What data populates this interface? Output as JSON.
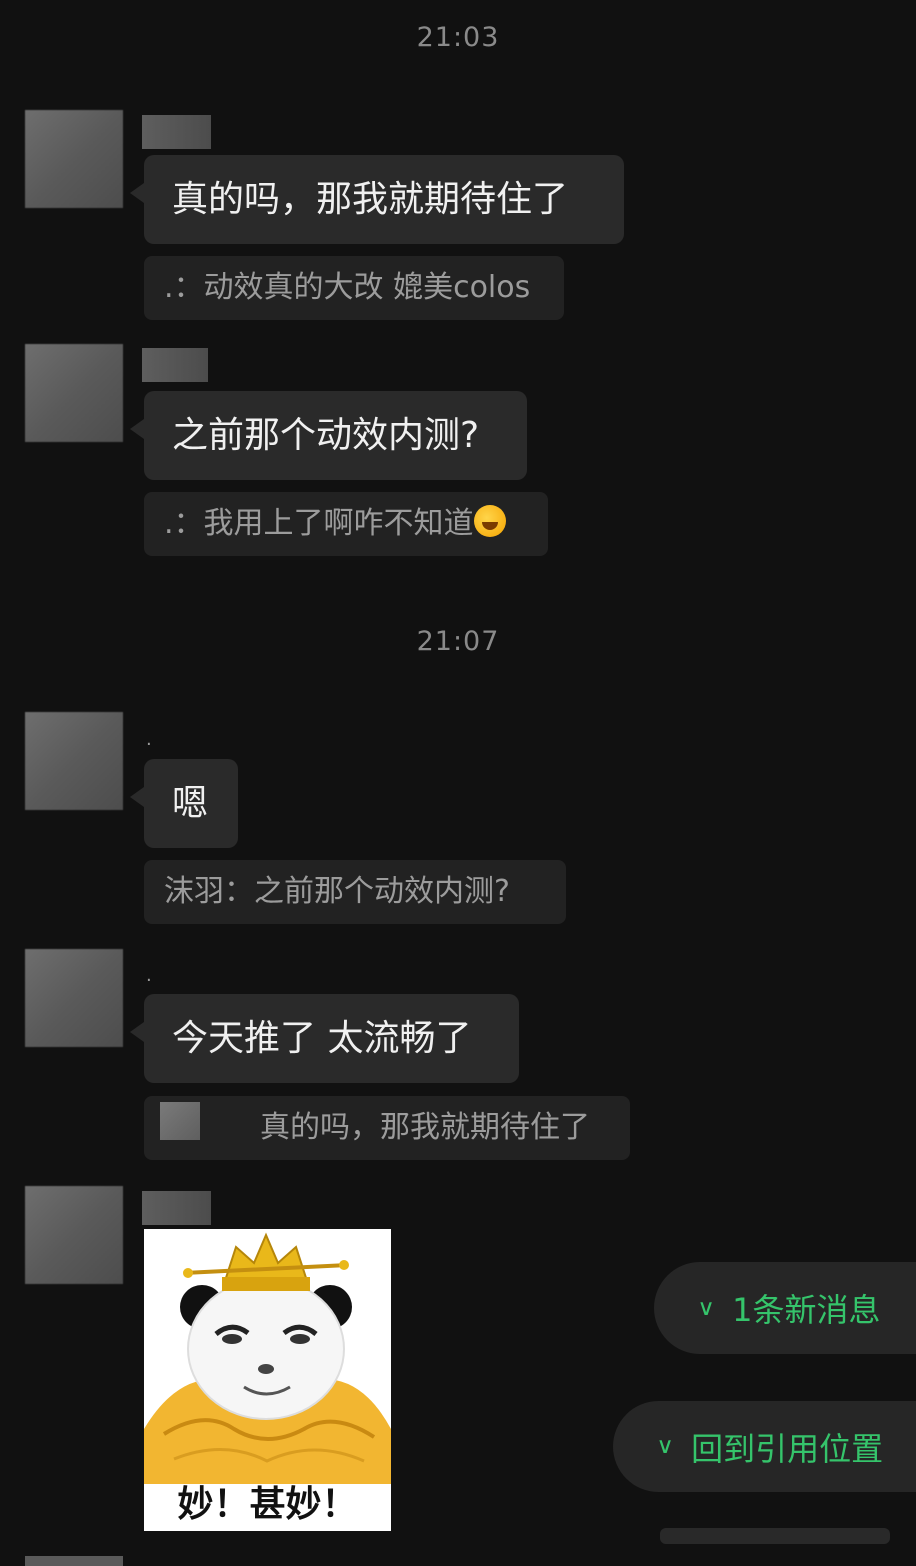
{
  "timestamps": [
    "21:03",
    "21:07"
  ],
  "messages": [
    {
      "text": "真的吗，那我就期待住了",
      "quote": ".：动效真的大改 媲美colos"
    },
    {
      "text": "之前那个动效内测?",
      "quote": ".：我用上了啊咋不知道"
    },
    {
      "sender": ".",
      "text": "嗯",
      "quote": "沫羽：之前那个动效内测?"
    },
    {
      "sender": ".",
      "text": "今天推了 太流畅了",
      "quote": "真的吗，那我就期待住了"
    },
    {
      "sticker_caption": "妙！甚妙！"
    }
  ],
  "icons": {
    "quote_emoji": "crying-laughing-emoji",
    "chevron": "double-chevron-down-icon"
  },
  "floating": {
    "new_messages": "1条新消息",
    "back_to_quote": "回到引用位置"
  },
  "colors": {
    "background": "#111111",
    "bubble": "#2a2a2a",
    "quote": "#222222",
    "accent_green": "#35c46b"
  }
}
